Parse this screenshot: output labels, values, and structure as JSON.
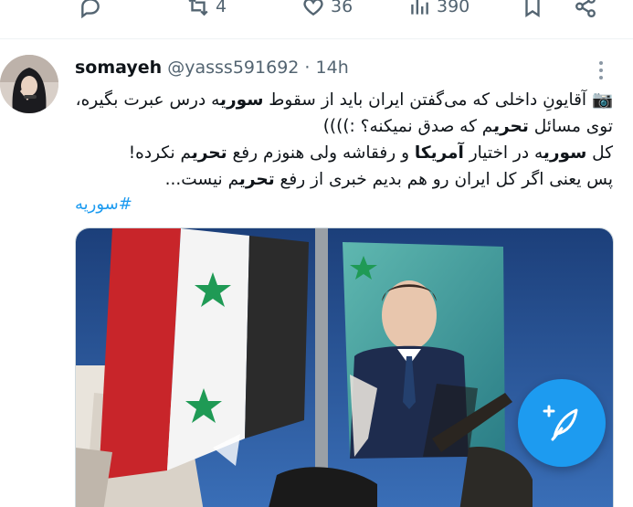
{
  "actions": {
    "reply_count": "",
    "retweet_count": "4",
    "like_count": "36",
    "view_count": "390",
    "icons": [
      "reply-icon",
      "retweet-icon",
      "heart-icon",
      "views-icon",
      "bookmark-icon",
      "share-icon"
    ]
  },
  "tweet": {
    "display_name": "somayeh",
    "handle": "@yasss591692",
    "separator": "·",
    "time": "14h",
    "lines": [
      [
        "📷 آقایونِ داخلی که می‌گفتن ایران باید از سقوط ",
        "سوری",
        "ه درس عبرت بگیره،"
      ],
      [
        "توی مسائل ",
        "تحری",
        "م که صدق نمیکنه؟ :))))"
      ],
      [
        "کل ",
        "سوری",
        "ه در اختیار ",
        "آمریکا",
        " و رفقاشه ولی هنوزم رفع ",
        "تحری",
        "م نکرده!"
      ],
      [
        "پس یعنی اگر کل ایران رو هم بدیم خبری از رفع ",
        "تحری",
        "م نیست..."
      ]
    ],
    "hashtag": "#سوریه"
  },
  "colors": {
    "accent": "#1d9bf0",
    "muted": "#536471",
    "text": "#0f1419"
  },
  "fab": {
    "icon": "compose-feather-plus-icon"
  }
}
